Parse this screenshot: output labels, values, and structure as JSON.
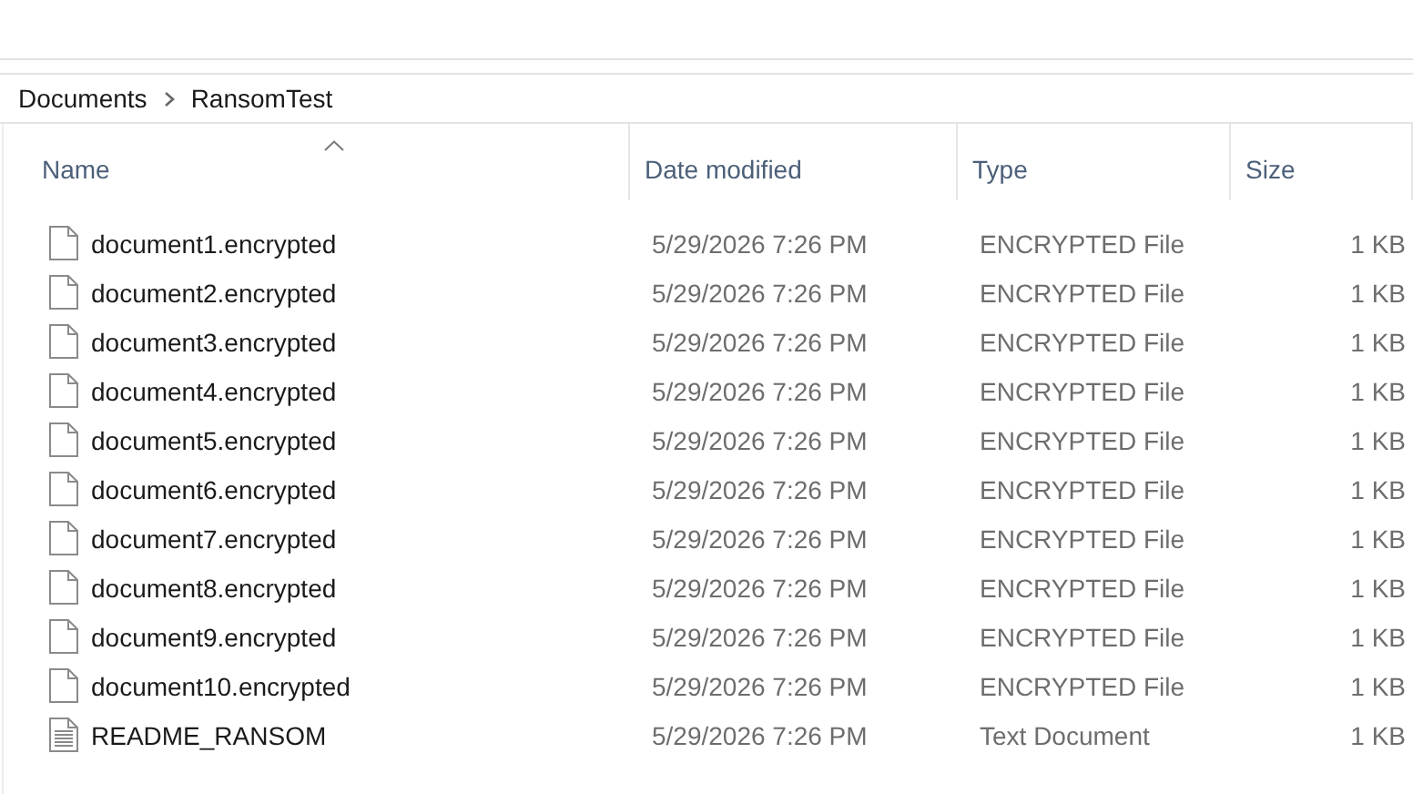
{
  "breadcrumb": [
    "Documents",
    "RansomTest"
  ],
  "columns": [
    {
      "label": "Name",
      "sorted": true
    },
    {
      "label": "Date modified",
      "sorted": false
    },
    {
      "label": "Type",
      "sorted": false
    },
    {
      "label": "Size",
      "sorted": false
    }
  ],
  "rows": [
    {
      "kind": "file",
      "name": "document1.encrypted",
      "date": "5/29/2026 7:26 PM",
      "type": "ENCRYPTED File",
      "size": "1 KB"
    },
    {
      "kind": "file",
      "name": "document2.encrypted",
      "date": "5/29/2026 7:26 PM",
      "type": "ENCRYPTED File",
      "size": "1 KB"
    },
    {
      "kind": "file",
      "name": "document3.encrypted",
      "date": "5/29/2026 7:26 PM",
      "type": "ENCRYPTED File",
      "size": "1 KB"
    },
    {
      "kind": "file",
      "name": "document4.encrypted",
      "date": "5/29/2026 7:26 PM",
      "type": "ENCRYPTED File",
      "size": "1 KB"
    },
    {
      "kind": "file",
      "name": "document5.encrypted",
      "date": "5/29/2026 7:26 PM",
      "type": "ENCRYPTED File",
      "size": "1 KB"
    },
    {
      "kind": "file",
      "name": "document6.encrypted",
      "date": "5/29/2026 7:26 PM",
      "type": "ENCRYPTED File",
      "size": "1 KB"
    },
    {
      "kind": "file",
      "name": "document7.encrypted",
      "date": "5/29/2026 7:26 PM",
      "type": "ENCRYPTED File",
      "size": "1 KB"
    },
    {
      "kind": "file",
      "name": "document8.encrypted",
      "date": "5/29/2026 7:26 PM",
      "type": "ENCRYPTED File",
      "size": "1 KB"
    },
    {
      "kind": "file",
      "name": "document9.encrypted",
      "date": "5/29/2026 7:26 PM",
      "type": "ENCRYPTED File",
      "size": "1 KB"
    },
    {
      "kind": "file",
      "name": "document10.encrypted",
      "date": "5/29/2026 7:26 PM",
      "type": "ENCRYPTED File",
      "size": "1 KB"
    },
    {
      "kind": "text",
      "name": "README_RANSOM",
      "date": "5/29/2026 7:26 PM",
      "type": "Text Document",
      "size": "1 KB"
    }
  ]
}
